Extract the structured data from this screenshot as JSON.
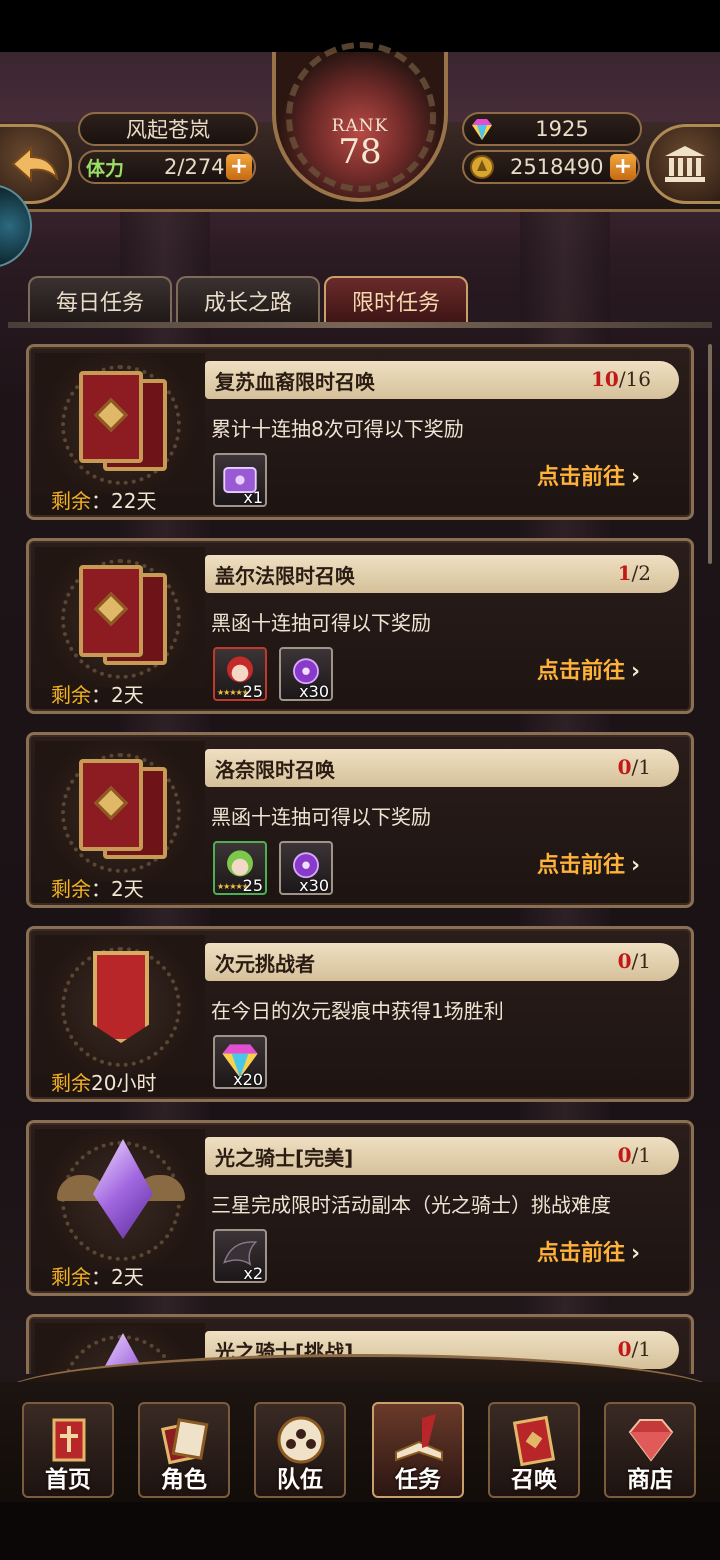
{
  "header": {
    "player_name": "风起苍岚",
    "stamina_label": "体力",
    "stamina_value": "2/274",
    "rank_label": "RANK",
    "rank_value": "78",
    "gems": "1925",
    "gold": "2518490",
    "plus": "+"
  },
  "tabs": [
    {
      "label": "每日任务",
      "active": false
    },
    {
      "label": "成长之路",
      "active": false
    },
    {
      "label": "限时任务",
      "active": true
    }
  ],
  "tasks": [
    {
      "title": "复苏血裔限时召唤",
      "progress_current": "10",
      "progress_total": "/16",
      "desc": "累计十连抽8次可得以下奖励",
      "remain_key": "剩余",
      "remain_val": "：22天",
      "rewards": [
        {
          "icon": "purple-chest-icon",
          "qty": "x1"
        }
      ],
      "action": "点击前往"
    },
    {
      "title": "盖尔法限时召唤",
      "progress_current": "1",
      "progress_total": "/2",
      "desc": "黑函十连抽可得以下奖励",
      "remain_key": "剩余",
      "remain_val": "：2天",
      "rewards": [
        {
          "icon": "red-hair-hero-icon",
          "qty": "25",
          "stars": "★★★★★"
        },
        {
          "icon": "purple-orb-icon",
          "qty": "x30"
        }
      ],
      "action": "点击前往"
    },
    {
      "title": "洛奈限时召唤",
      "progress_current": "0",
      "progress_total": "/1",
      "desc": "黑函十连抽可得以下奖励",
      "remain_key": "剩余",
      "remain_val": "：2天",
      "rewards": [
        {
          "icon": "green-hair-hero-icon",
          "qty": "25",
          "stars": "★★★★★"
        },
        {
          "icon": "purple-orb-icon",
          "qty": "x30"
        }
      ],
      "action": "点击前往"
    },
    {
      "title": "次元挑战者",
      "progress_current": "0",
      "progress_total": "/1",
      "desc": "在今日的次元裂痕中获得1场胜利",
      "remain_key": "剩余",
      "remain_val": "20小时",
      "rewards": [
        {
          "icon": "rainbow-gem-icon",
          "qty": "x20"
        }
      ],
      "action": ""
    },
    {
      "title": "光之骑士[完美]",
      "progress_current": "0",
      "progress_total": "/1",
      "desc": "三星完成限时活动副本（光之骑士）挑战难度",
      "remain_key": "剩余",
      "remain_val": "：2天",
      "rewards": [
        {
          "icon": "dark-wing-icon",
          "qty": "x2"
        }
      ],
      "action": "点击前往"
    },
    {
      "title": "光之骑士[挑战]",
      "progress_current": "0",
      "progress_total": "/1",
      "desc": "",
      "remain_key": "",
      "remain_val": "",
      "rewards": [],
      "action": ""
    }
  ],
  "nav": [
    {
      "label": "首页",
      "icon": "home-banner-icon",
      "active": false
    },
    {
      "label": "角色",
      "icon": "character-card-icon",
      "active": false
    },
    {
      "label": "队伍",
      "icon": "team-shield-icon",
      "active": false
    },
    {
      "label": "任务",
      "icon": "quest-book-icon",
      "active": true
    },
    {
      "label": "召唤",
      "icon": "summon-card-icon",
      "active": false
    },
    {
      "label": "商店",
      "icon": "shop-gem-icon",
      "active": false
    }
  ],
  "colors": {
    "accent": "#ffb23a",
    "progress_red": "#c21818",
    "remain_gold": "#f2b020"
  }
}
